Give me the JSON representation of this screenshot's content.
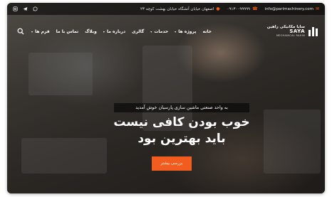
{
  "topbar": {
    "email": "info@parimachinery.com",
    "phone": "۰۹۱۳۰۰۹۹۹۹۹",
    "address": "اصفهان خیابان آتشگاه خیابان بهشت کوچه ۲۳",
    "socials": [
      "instagram-icon",
      "telegram-icon",
      "whatsapp-icon"
    ]
  },
  "nav": {
    "items": [
      {
        "label": "خانه",
        "caret": false
      },
      {
        "label": "پروژه ها",
        "caret": true
      },
      {
        "label": "خدمات",
        "caret": true
      },
      {
        "label": "گالری",
        "caret": false
      },
      {
        "label": "درباره ما",
        "caret": true
      },
      {
        "label": "وبلاگ",
        "caret": false
      },
      {
        "label": "تماس با ما",
        "caret": false
      },
      {
        "label": "فرم ها",
        "caret": true
      }
    ]
  },
  "logo": {
    "fa": "سایا مکانیکی راهین",
    "en": "SAYA",
    "sub": "MECHANICAL RAHIN"
  },
  "hero": {
    "tagline": "به واحد صنعتی ماشین سازی پارسیان خوش آمدید",
    "headline_line1": "خوب بودن کافی نیست",
    "headline_line2": "باید بهترین بود",
    "cta_label": "بررسی بیشتر"
  },
  "colors": {
    "accent": "#f25c1e"
  }
}
